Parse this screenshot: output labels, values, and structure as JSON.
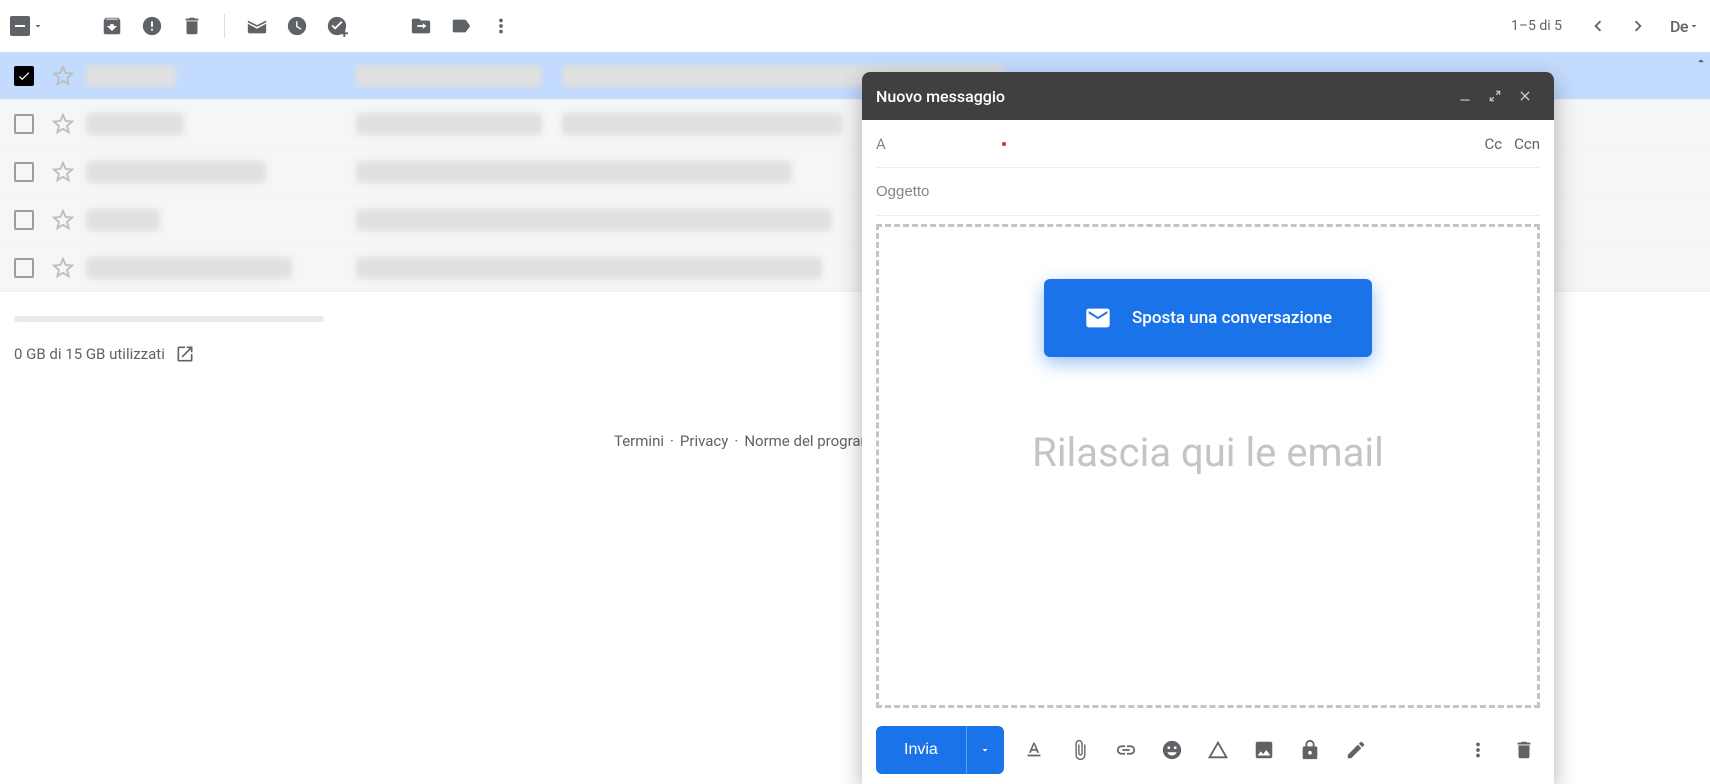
{
  "toolbar": {
    "pager_text": "1–5 di 5",
    "input_tools_label": "De"
  },
  "emails": [
    {
      "checked": true,
      "read": false,
      "sender_blur_w": 90,
      "subj_segs": [
        186,
        442
      ]
    },
    {
      "checked": false,
      "read": true,
      "sender_blur_w": 98,
      "subj_segs": [
        186,
        280
      ]
    },
    {
      "checked": false,
      "read": true,
      "sender_blur_w": 180,
      "subj_segs": [
        436
      ]
    },
    {
      "checked": false,
      "read": true,
      "sender_blur_w": 74,
      "subj_segs": [
        476
      ]
    },
    {
      "checked": false,
      "read": true,
      "sender_blur_w": 206,
      "subj_segs": [
        466
      ]
    }
  ],
  "footer": {
    "storage": "0 GB di 15 GB utilizzati",
    "links": {
      "terms": "Termini",
      "privacy": "Privacy",
      "policies": "Norme del programma"
    }
  },
  "compose": {
    "title": "Nuovo messaggio",
    "to_label": "A",
    "cc": "Cc",
    "bcc": "Ccn",
    "subject_placeholder": "Oggetto",
    "chip_label": "Sposta una conversazione",
    "drop_text": "Rilascia qui le email",
    "send_label": "Invia"
  }
}
